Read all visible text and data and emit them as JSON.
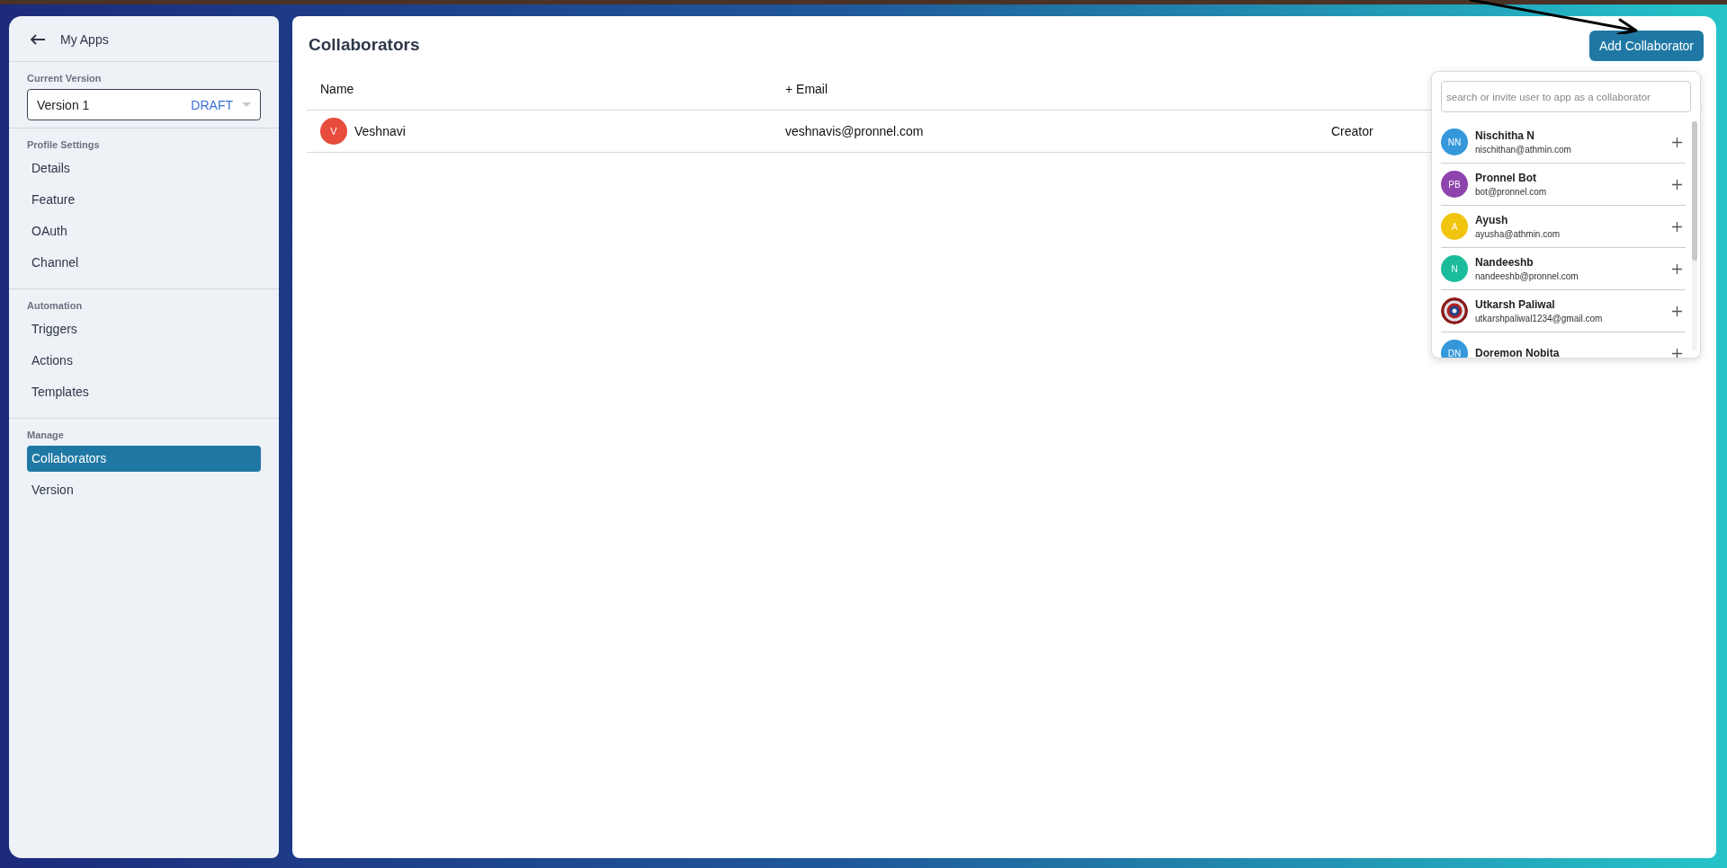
{
  "sidebar": {
    "back_label": "My Apps",
    "version_label": "Current Version",
    "version": {
      "value": "Version 1",
      "status": "DRAFT"
    },
    "sections": [
      {
        "title": "Profile Settings",
        "items": [
          {
            "label": "Details",
            "selected": false
          },
          {
            "label": "Feature",
            "selected": false
          },
          {
            "label": "OAuth",
            "selected": false
          },
          {
            "label": "Channel",
            "selected": false
          }
        ]
      },
      {
        "title": "Automation",
        "items": [
          {
            "label": "Triggers",
            "selected": false
          },
          {
            "label": "Actions",
            "selected": false
          },
          {
            "label": "Templates",
            "selected": false
          }
        ]
      },
      {
        "title": "Manage",
        "items": [
          {
            "label": "Collaborators",
            "selected": true
          },
          {
            "label": "Version",
            "selected": false
          }
        ]
      }
    ]
  },
  "main": {
    "title": "Collaborators",
    "add_button": "Add Collaborator",
    "table": {
      "columns": [
        "Name",
        "+ Email"
      ],
      "rows": [
        {
          "initials": "V",
          "color": "#e74c3c",
          "name": "Veshnavi",
          "email": "veshnavis@pronnel.com",
          "role": "Creator"
        }
      ]
    }
  },
  "invite_popup": {
    "placeholder": "search or invite user to app as a collaborator",
    "users": [
      {
        "kind": "initials",
        "initials": "NN",
        "color": "#3498db",
        "name": "Nischitha N",
        "email": "nischithan@athmin.com"
      },
      {
        "kind": "initials",
        "initials": "PB",
        "color": "#8e44ad",
        "name": "Pronnel Bot",
        "email": "bot@pronnel.com"
      },
      {
        "kind": "initials",
        "initials": "A",
        "color": "#f1c40f",
        "name": "Ayush",
        "email": "ayusha@athmin.com"
      },
      {
        "kind": "initials",
        "initials": "N",
        "color": "#1abc9c",
        "name": "Nandeeshb",
        "email": "nandeeshb@pronnel.com"
      },
      {
        "kind": "picture",
        "name": "Utkarsh Paliwal",
        "email": "utkarshpaliwal1234@gmail.com"
      },
      {
        "kind": "initials",
        "initials": "DN",
        "color": "#3498db",
        "name": "Doremon Nobita"
      }
    ]
  }
}
